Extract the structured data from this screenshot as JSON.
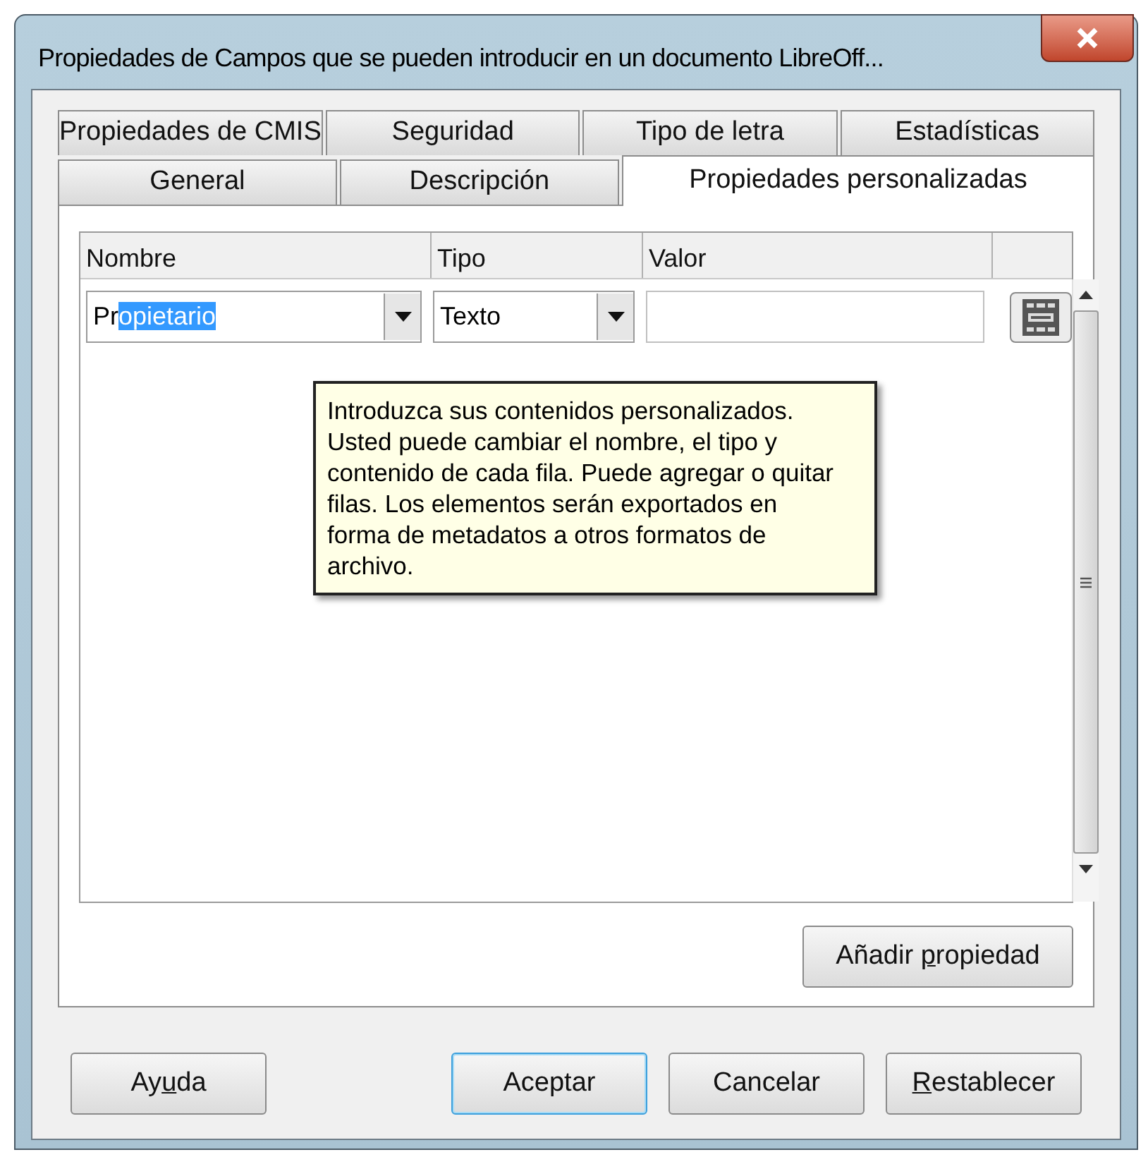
{
  "window": {
    "title": "Propiedades de Campos que se pueden introducir en un documento LibreOff..."
  },
  "tab_rows": [
    [
      {
        "label": "Propiedades de CMIS",
        "selected": false
      },
      {
        "label": "Seguridad",
        "selected": false
      },
      {
        "label": "Tipo de letra",
        "selected": false
      },
      {
        "label": "Estadísticas",
        "selected": false
      }
    ],
    [
      {
        "label": "General",
        "selected": false
      },
      {
        "label": "Descripción",
        "selected": false
      },
      {
        "label": "Propiedades personalizadas",
        "selected": true
      }
    ]
  ],
  "table": {
    "columns": [
      "Nombre",
      "Tipo",
      "Valor"
    ],
    "rows": [
      {
        "name_unselected": "Pr",
        "name_selected": "opietario",
        "type": "Texto"
      }
    ]
  },
  "tooltip": "Introduzca sus contenidos personalizados. Usted puede cambiar el nombre, el tipo y contenido de cada fila. Puede agregar o quitar filas. Los elementos serán exportados en forma de metadatos a otros formatos de archivo.",
  "add_button": {
    "before": "Añadir ",
    "key": "p",
    "after": "ropiedad"
  },
  "buttons": [
    {
      "before": "Ay",
      "key": "u",
      "after": "da",
      "default": false
    },
    {
      "before": "Aceptar",
      "default": true
    },
    {
      "before": "Cancelar",
      "default": false
    },
    {
      "key": "R",
      "after": "establecer",
      "default": false
    }
  ]
}
